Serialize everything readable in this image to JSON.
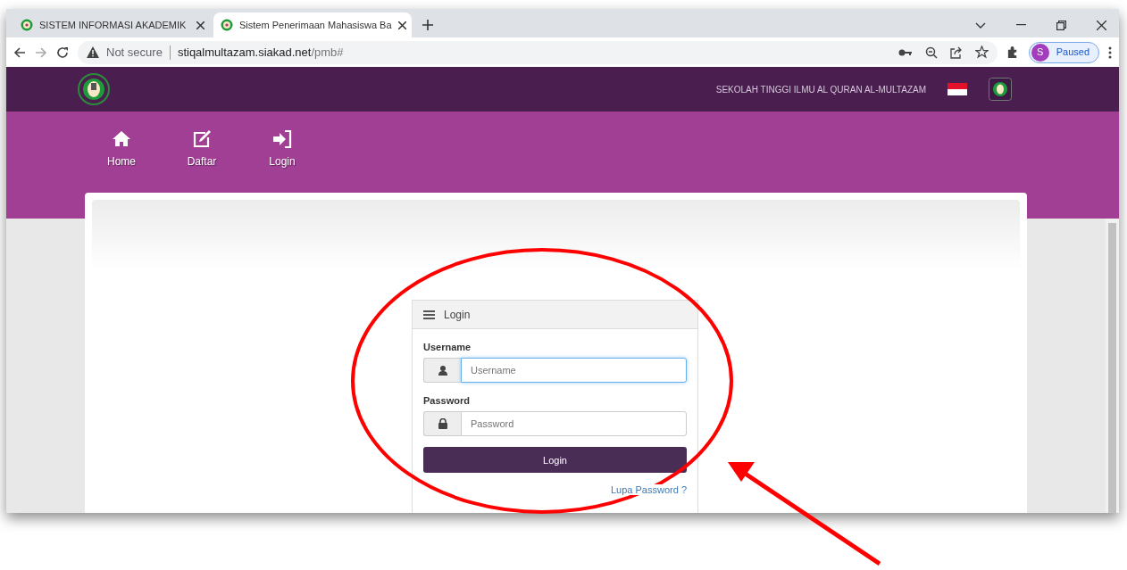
{
  "browser": {
    "tabs": [
      {
        "title": "SISTEM INFORMASI AKADEMIK",
        "selected": false
      },
      {
        "title": "Sistem Penerimaan Mahasiswa Ba",
        "selected": true
      }
    ],
    "security": "Not secure",
    "url_host": "stiqalmultazam.siakad.net",
    "url_path": "/pmb#",
    "profile_initial": "S",
    "profile_status": "Paused"
  },
  "header": {
    "institution": "SEKOLAH TINGGI ILMU AL QURAN AL-MULTAZAM"
  },
  "nav": [
    {
      "kind": "home",
      "label": "Home"
    },
    {
      "kind": "edit",
      "label": "Daftar"
    },
    {
      "kind": "login",
      "label": "Login"
    }
  ],
  "login_panel": {
    "title": "Login",
    "username_label": "Username",
    "username_placeholder": "Username",
    "password_label": "Password",
    "password_placeholder": "Password",
    "button": "Login",
    "forgot_link": "Lupa Password ?"
  }
}
